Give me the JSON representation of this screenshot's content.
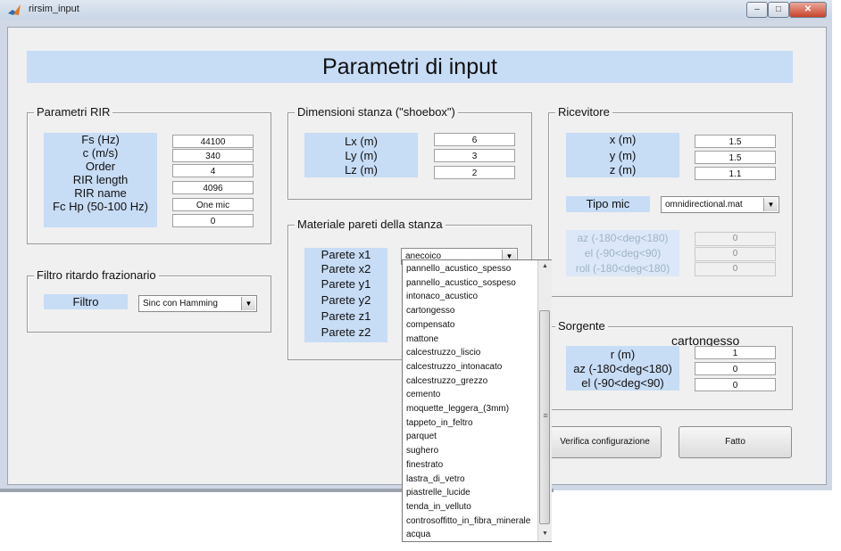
{
  "window": {
    "title": "rirsim_input"
  },
  "header": {
    "title": "Parametri di input"
  },
  "rir_params": {
    "title": "Parametri RIR",
    "rows": [
      {
        "label": "Fs (Hz)",
        "value": "44100"
      },
      {
        "label": "c (m/s)",
        "value": "340"
      },
      {
        "label": "Order",
        "value": "4"
      },
      {
        "label": "RIR length",
        "value": "4096"
      },
      {
        "label": "RIR name",
        "value": "One mic"
      },
      {
        "label": "Fc Hp (50-100 Hz)",
        "value": "0"
      }
    ]
  },
  "filter": {
    "title": "Filtro ritardo frazionario",
    "label": "Filtro",
    "selected": "Sinc con Hamming"
  },
  "room": {
    "title": "Dimensioni stanza (\"shoebox\")",
    "rows": [
      {
        "label": "Lx (m)",
        "value": "6"
      },
      {
        "label": "Ly (m)",
        "value": "3"
      },
      {
        "label": "Lz (m)",
        "value": "2"
      }
    ]
  },
  "walls": {
    "title": "Materiale pareti della stanza",
    "labels": [
      "Parete x1",
      "Parete x2",
      "Parete y1",
      "Parete y2",
      "Parete z1",
      "Parete z2"
    ],
    "x1_selected": "anecoico",
    "dropdown_options": [
      "pannello_acustico_spesso",
      "pannello_acustico_sospeso",
      "intonaco_acustico",
      "cartongesso",
      "compensato",
      "mattone",
      "calcestruzzo_liscio",
      "calcestruzzo_intonacato",
      "calcestruzzo_grezzo",
      "cemento",
      "moquette_leggera_(3mm)",
      "tappeto_in_feltro",
      "parquet",
      "sughero",
      "finestrato",
      "lastra_di_vetro",
      "piastrelle_lucide",
      "tenda_in_velluto",
      "controsoffitto_in_fibra_minerale",
      "acqua"
    ]
  },
  "receiver": {
    "title": "Ricevitore",
    "rows": [
      {
        "label": "x (m)",
        "value": "1.5"
      },
      {
        "label": "y (m)",
        "value": "1.5"
      },
      {
        "label": "z (m)",
        "value": "1.1"
      }
    ],
    "mic_label": "Tipo mic",
    "mic_selected": "omnidirectional.mat",
    "angles": [
      {
        "label": "az (-180<deg<180)",
        "value": "0"
      },
      {
        "label": "el (-90<deg<90)",
        "value": "0"
      },
      {
        "label": "roll (-180<deg<180)",
        "value": "0"
      }
    ]
  },
  "source": {
    "title": "Sorgente",
    "overlay_text": "cartongesso",
    "rows": [
      {
        "label": "r (m)",
        "value": "1"
      },
      {
        "label": "az (-180<deg<180)",
        "value": "0"
      },
      {
        "label": "el (-90<deg<90)",
        "value": "0"
      }
    ]
  },
  "buttons": {
    "verify": "Verifica configurazione",
    "done": "Fatto"
  },
  "colors": {
    "label_bg": "#c7dcf5",
    "header_bg": "#c7dcf5",
    "window_bg": "#f0f0f0"
  }
}
